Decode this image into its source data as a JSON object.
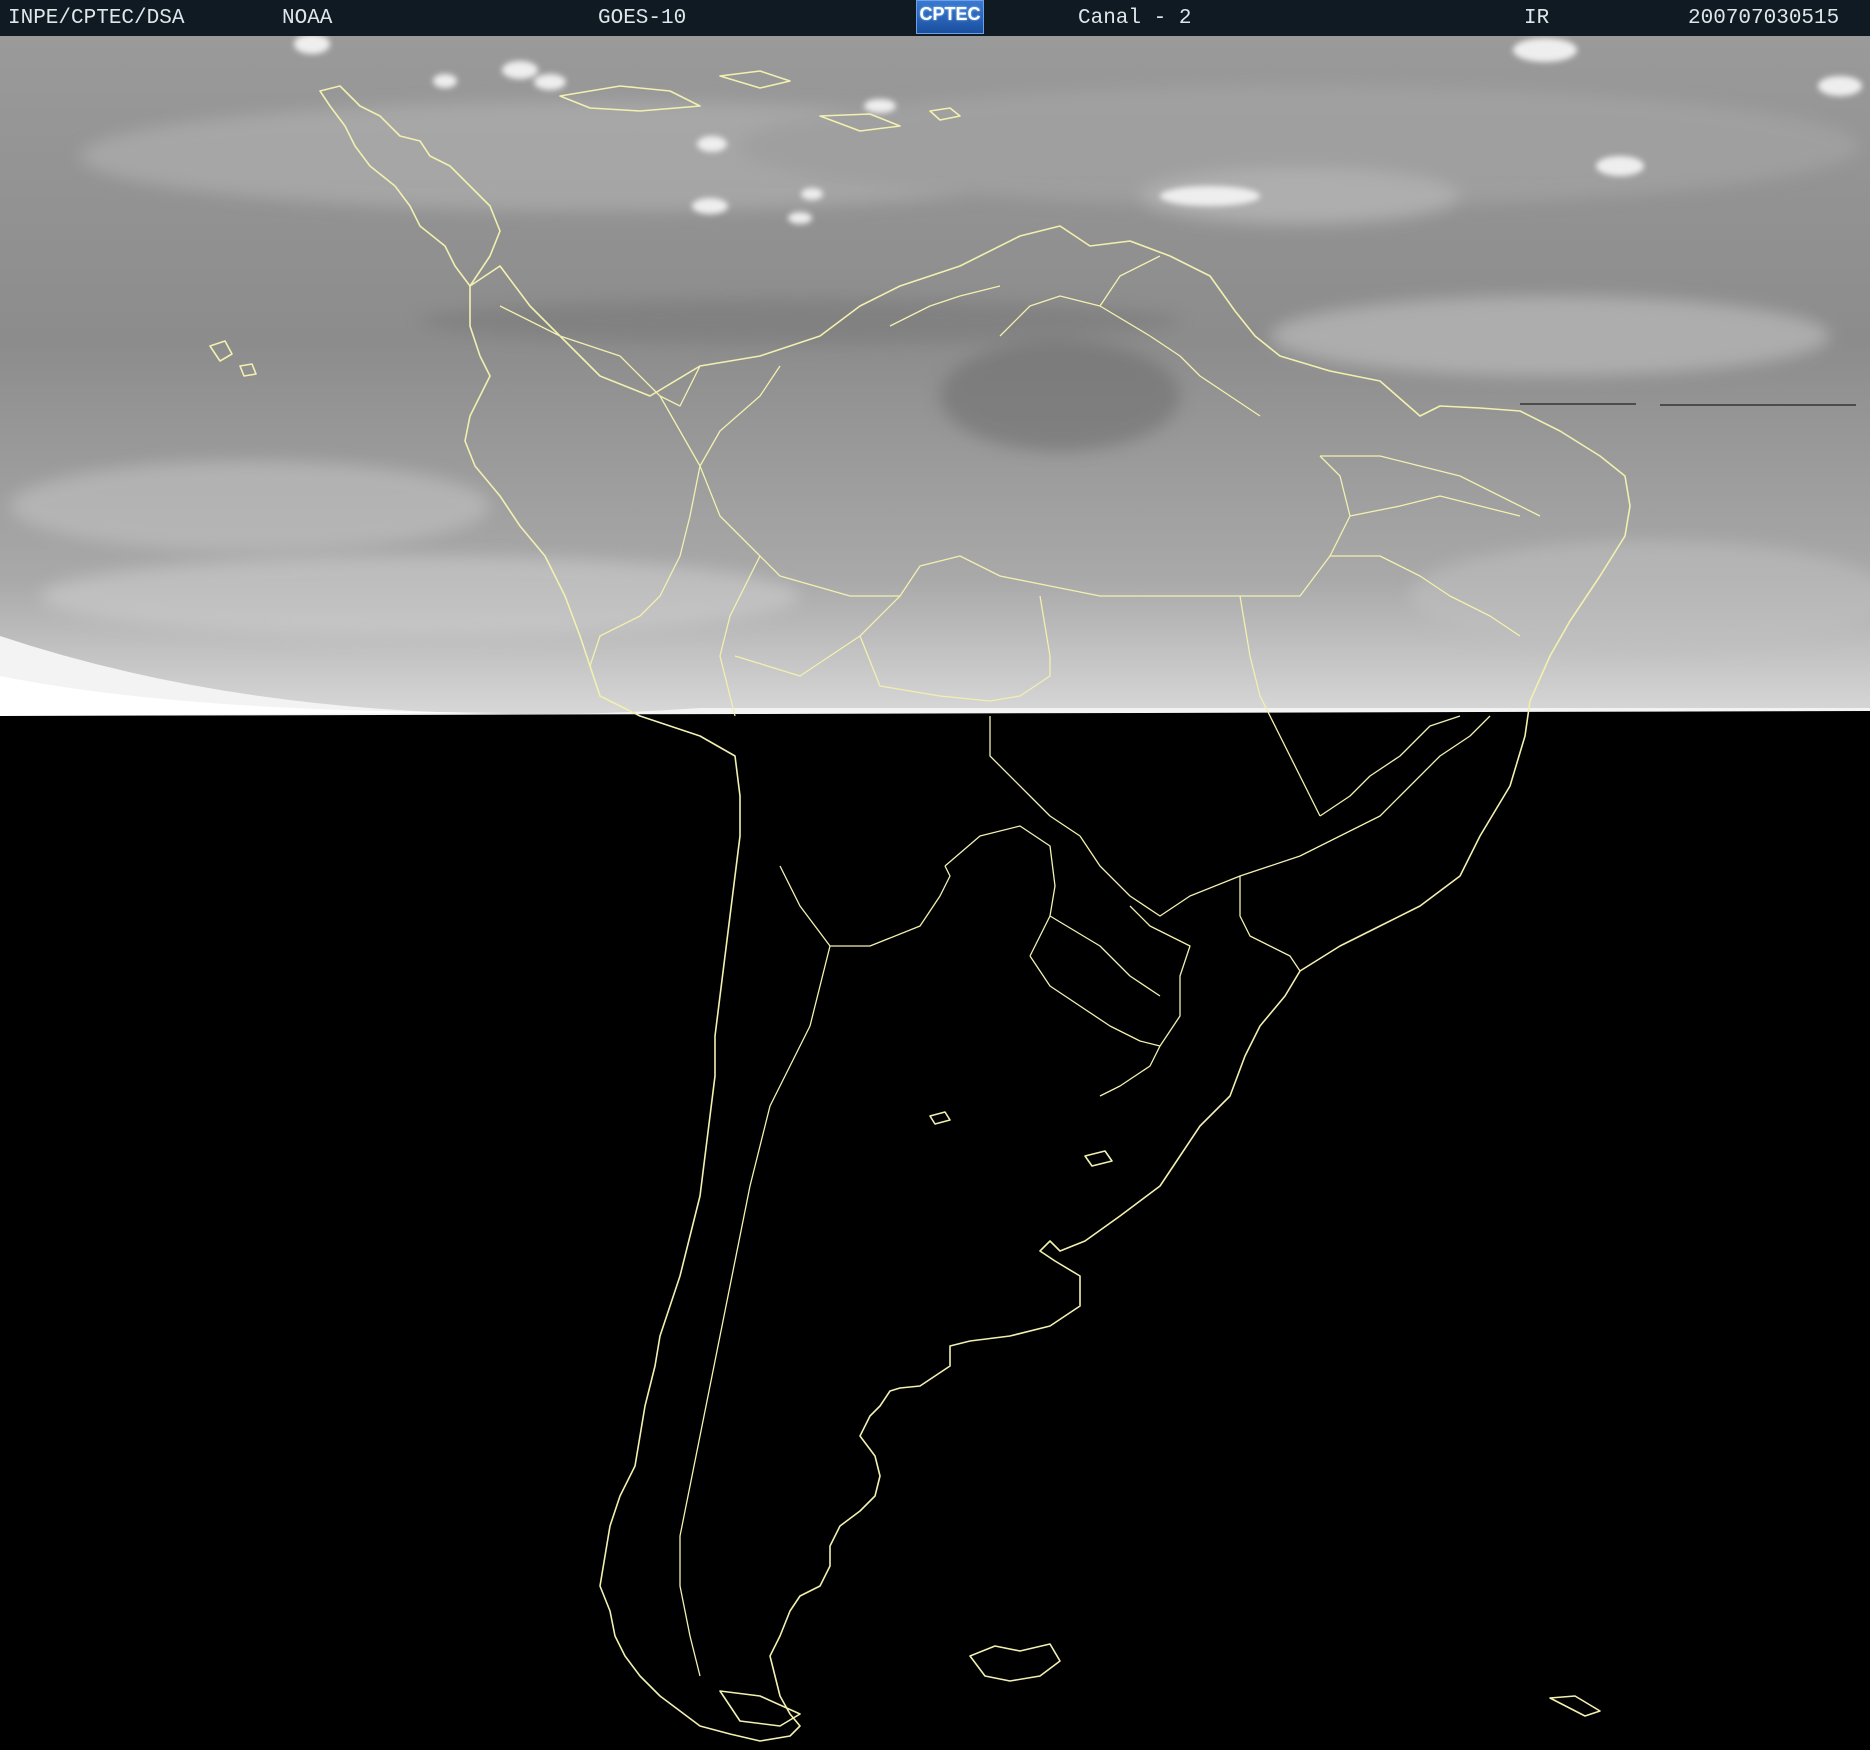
{
  "header": {
    "agency": "INPE/CPTEC/DSA",
    "operator": "NOAA",
    "satellite": "GOES-10",
    "logo_text": "CPTEC",
    "channel": "Canal - 2",
    "band": "IR",
    "timestamp": "200707030515"
  },
  "colors": {
    "header_bg": "#101a22",
    "header_text": "#dfe6ea",
    "coastline": "#f2f0b0",
    "night_side": "#000000",
    "cloud_gray": "#8f8f8f"
  },
  "map": {
    "region": "South America",
    "day_night_terminator": true
  }
}
